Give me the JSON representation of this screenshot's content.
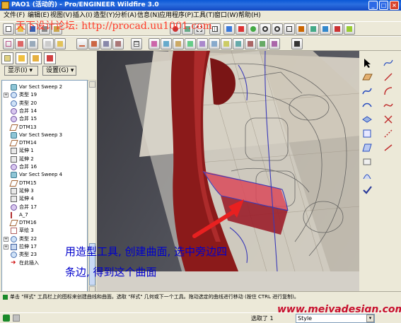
{
  "window": {
    "title": "PAO1 (活动的) - Pro/ENGINEER Wildfire 3.0",
    "buttons": [
      "_",
      "□",
      "×"
    ]
  },
  "menu": [
    "文件(F)",
    "编辑(E)",
    "视图(V)",
    "插入(I)",
    "造型(Y)",
    "分析(A)",
    "信息(N)",
    "应用程序(P)",
    "工具(T)",
    "窗口(W)",
    "帮助(H)"
  ],
  "overlay": {
    "site_label": "天下设计论坛: http://procad.uu1001.com"
  },
  "left_panel": {
    "show_button": "显示(I) ▾",
    "settings_button": "设置(G) ▾",
    "tree": [
      {
        "label": "Var Sect Sweep 2",
        "icon": "sweep-icon",
        "indent": 0
      },
      {
        "label": "类型 19",
        "icon": "surface-icon",
        "indent": 0,
        "expand": true
      },
      {
        "label": "类型 20",
        "icon": "surface-icon",
        "indent": 0
      },
      {
        "label": "合并 14",
        "icon": "merge-icon",
        "indent": 0
      },
      {
        "label": "合并 15",
        "icon": "merge-icon",
        "indent": 0
      },
      {
        "label": "DTM13",
        "icon": "datum-plane-icon",
        "indent": 0
      },
      {
        "label": "Var Sect Sweep 3",
        "icon": "sweep-icon",
        "indent": 0
      },
      {
        "label": "DTM14",
        "icon": "datum-plane-icon",
        "indent": 0
      },
      {
        "label": "延伸 1",
        "icon": "extend-icon",
        "indent": 0
      },
      {
        "label": "延伸 2",
        "icon": "extend-icon",
        "indent": 0
      },
      {
        "label": "合并 16",
        "icon": "merge-icon",
        "indent": 0
      },
      {
        "label": "Var Sect Sweep 4",
        "icon": "sweep-icon",
        "indent": 0
      },
      {
        "label": "DTM15",
        "icon": "datum-plane-icon",
        "indent": 0
      },
      {
        "label": "延伸 3",
        "icon": "extend-icon",
        "indent": 0
      },
      {
        "label": "延伸 4",
        "icon": "extend-icon",
        "indent": 0
      },
      {
        "label": "合并 17",
        "icon": "merge-icon",
        "indent": 0
      },
      {
        "label": "A_7",
        "icon": "axis-icon",
        "indent": 0
      },
      {
        "label": "DTM16",
        "icon": "datum-plane-icon",
        "indent": 0
      },
      {
        "label": "草绘 3",
        "icon": "sketch-icon",
        "indent": 0
      },
      {
        "label": "类型 22",
        "icon": "surface-icon",
        "indent": 0,
        "expand": true
      },
      {
        "label": "拉伸 17",
        "icon": "extrude-icon",
        "indent": 0,
        "expand": true
      },
      {
        "label": "类型 23",
        "icon": "surface-icon",
        "indent": 0
      },
      {
        "label": "在此插入",
        "icon": "insert-here-icon",
        "indent": 0
      }
    ]
  },
  "annotation": {
    "line1": "用造型工具, 创建曲面, 选中旁边四",
    "line2": "条边, 得到这个曲面"
  },
  "message": "单击 \"样式\" 工具栏上的图标来创建曲线和曲面。选取 \"样式\" 几何或下一个工具。拖动选定的曲线进行移动 (按住 CTRL 进行复制)。",
  "status": {
    "selected": "选取了 1",
    "filter": "Style"
  },
  "watermark": "www.meiyadesign.com",
  "colors": {
    "surface_red": "#8b1a1a",
    "annotation_blue": "#0000cc",
    "overlay_red": "#ff3b2a",
    "watermark_red": "#c8102e"
  }
}
